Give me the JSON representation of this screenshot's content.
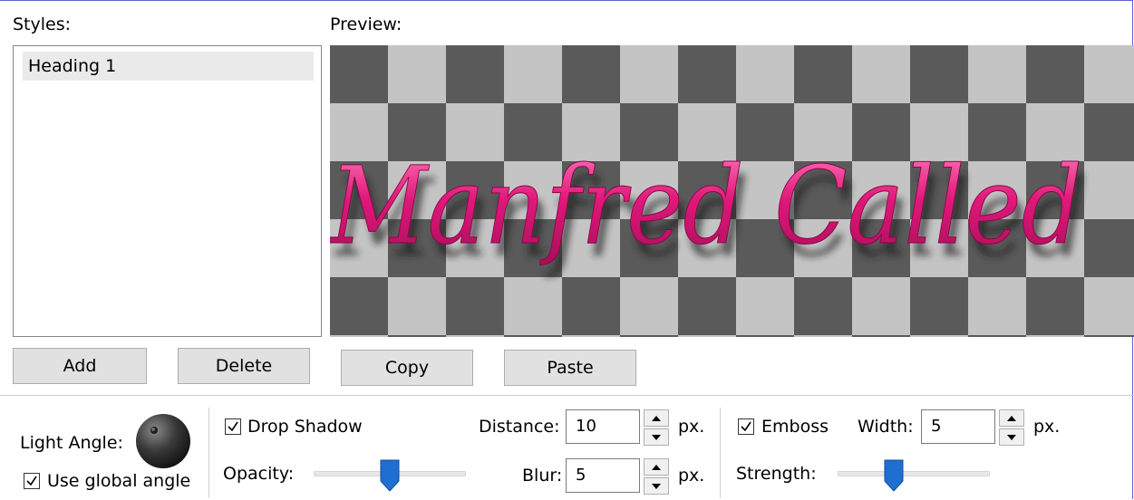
{
  "labels": {
    "styles": "Styles:",
    "preview": "Preview:",
    "light_angle": "Light Angle:",
    "use_global_angle": "Use global angle",
    "drop_shadow": "Drop Shadow",
    "distance": "Distance:",
    "opacity": "Opacity:",
    "blur": "Blur:",
    "emboss": "Emboss",
    "width": "Width:",
    "strength": "Strength:",
    "px": "px."
  },
  "styles_list": [
    "Heading 1"
  ],
  "preview_text": "Manfred Called",
  "buttons": {
    "add": "Add",
    "delete": "Delete",
    "copy": "Copy",
    "paste": "Paste"
  },
  "values": {
    "distance": "10",
    "blur": "5",
    "width": "5"
  },
  "checkboxes": {
    "use_global_angle": true,
    "drop_shadow": true,
    "emboss": true
  },
  "sliders": {
    "opacity": 0.5,
    "strength": 0.35
  },
  "colors": {
    "text_fill": "#e0187a",
    "checker_dark": "#5a5a5a",
    "checker_light": "#c4c4c4",
    "slider_thumb": "#1f6fd0"
  },
  "icons": {
    "knob": "light-angle-knob-icon",
    "check": "check-icon"
  }
}
